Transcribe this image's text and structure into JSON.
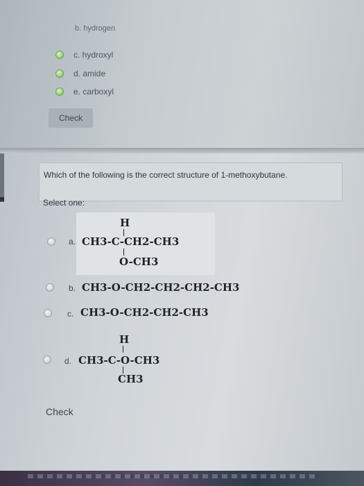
{
  "top_options": {
    "partial_label": "b. hydrogen",
    "items": [
      {
        "label": "c. hydroxyl"
      },
      {
        "label": "d. amide"
      },
      {
        "label": "e. carboxyl"
      }
    ]
  },
  "check_top_label": "Check",
  "question": {
    "text": "Which of the following is the correct structure of 1-methoxybutane.",
    "select_one": "Select one:"
  },
  "answers": [
    {
      "letter": "a.",
      "formula": "CH3-C-CH2-CH3",
      "top": "H",
      "bottom": "O-CH3"
    },
    {
      "letter": "b.",
      "formula": "CH3-O-CH2-CH2-CH2-CH3"
    },
    {
      "letter": "c.",
      "formula": "CH3-O-CH2-CH2-CH3"
    },
    {
      "letter": "d.",
      "formula": "CH3-C-O-CH3",
      "top": "H",
      "bottom": "CH3"
    }
  ],
  "check_bottom_label": "Check"
}
